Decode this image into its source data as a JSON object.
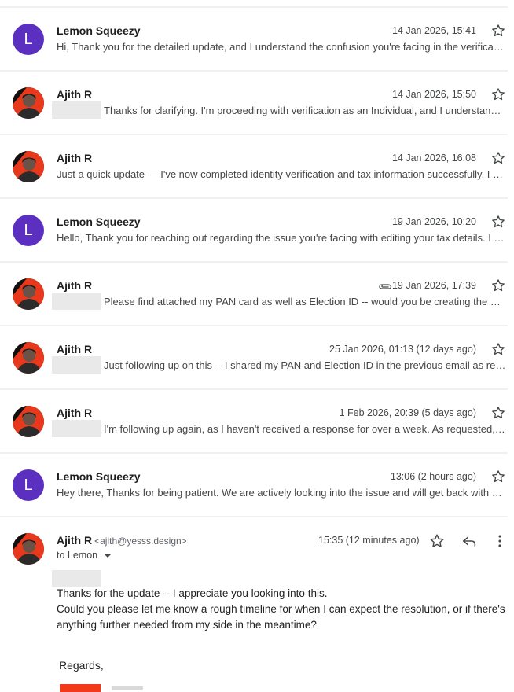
{
  "threads": [
    {
      "sender": "Lemon Squeezy",
      "avatar": "letter",
      "initial": "L",
      "date": "14 Jan 2026, 15:41",
      "redacted": false,
      "attachment": false,
      "snippet": "Hi, Thank you for the detailed update, and I understand the confusion you're facing in the verificat…"
    },
    {
      "sender": "Ajith R",
      "avatar": "photo",
      "date": "14 Jan 2026, 15:50",
      "redacted": true,
      "attachment": false,
      "snippet": "Thanks for clarifying. I'm proceeding with verification as an Individual, and I understand…"
    },
    {
      "sender": "Ajith R",
      "avatar": "photo",
      "date": "14 Jan 2026, 16:08",
      "redacted": false,
      "attachment": false,
      "snippet": "Just a quick update — I've now completed identity verification and tax information successfully. I …"
    },
    {
      "sender": "Lemon Squeezy",
      "avatar": "letter",
      "initial": "L",
      "date": "19 Jan 2026, 10:20",
      "redacted": false,
      "attachment": false,
      "snippet": "Hello, Thank you for reaching out regarding the issue you're facing with editing your tax details. I …"
    },
    {
      "sender": "Ajith R",
      "avatar": "photo",
      "date": "19 Jan 2026, 17:39",
      "redacted": true,
      "attachment": true,
      "snippet": "Please find attached my PAN card as well as Election ID -- would you be creating the …"
    },
    {
      "sender": "Ajith R",
      "avatar": "photo",
      "date": "25 Jan 2026, 01:13 (12 days ago)",
      "redacted": true,
      "attachment": false,
      "snippet": "Just following up on this -- I shared my PAN and Election ID in the previous email as re…"
    },
    {
      "sender": "Ajith R",
      "avatar": "photo",
      "date": "1 Feb 2026, 20:39 (5 days ago)",
      "redacted": true,
      "attachment": false,
      "snippet": "I'm following up again, as I haven't received a response for over a week. As requested,…"
    },
    {
      "sender": "Lemon Squeezy",
      "avatar": "letter",
      "initial": "L",
      "date": "13:06 (2 hours ago)",
      "redacted": false,
      "attachment": false,
      "snippet": "Hey there, Thanks for being patient. We are actively looking into the issue and will get back with a…"
    }
  ],
  "expanded": {
    "sender": "Ajith R",
    "email": "<ajith@yesss.design>",
    "to": "to Lemon",
    "time": "15:35 (12 minutes ago)",
    "body_line1": "Thanks for the update -- I appreciate you looking into this.",
    "body_line2": "Could you please let me know a rough timeline for when I can expect the resolution, or if there's",
    "body_line3": "anything further needed from my side in the meantime?",
    "regards": "Regards,"
  },
  "icons": {
    "star": "star-icon",
    "reply": "reply-icon",
    "more": "more-vert-icon",
    "attachment": "paperclip-icon",
    "dropdown": "caret-down-icon"
  },
  "colors": {
    "avatar_letter_bg": "#5b2fc0",
    "accent_red": "#f23a1a"
  }
}
